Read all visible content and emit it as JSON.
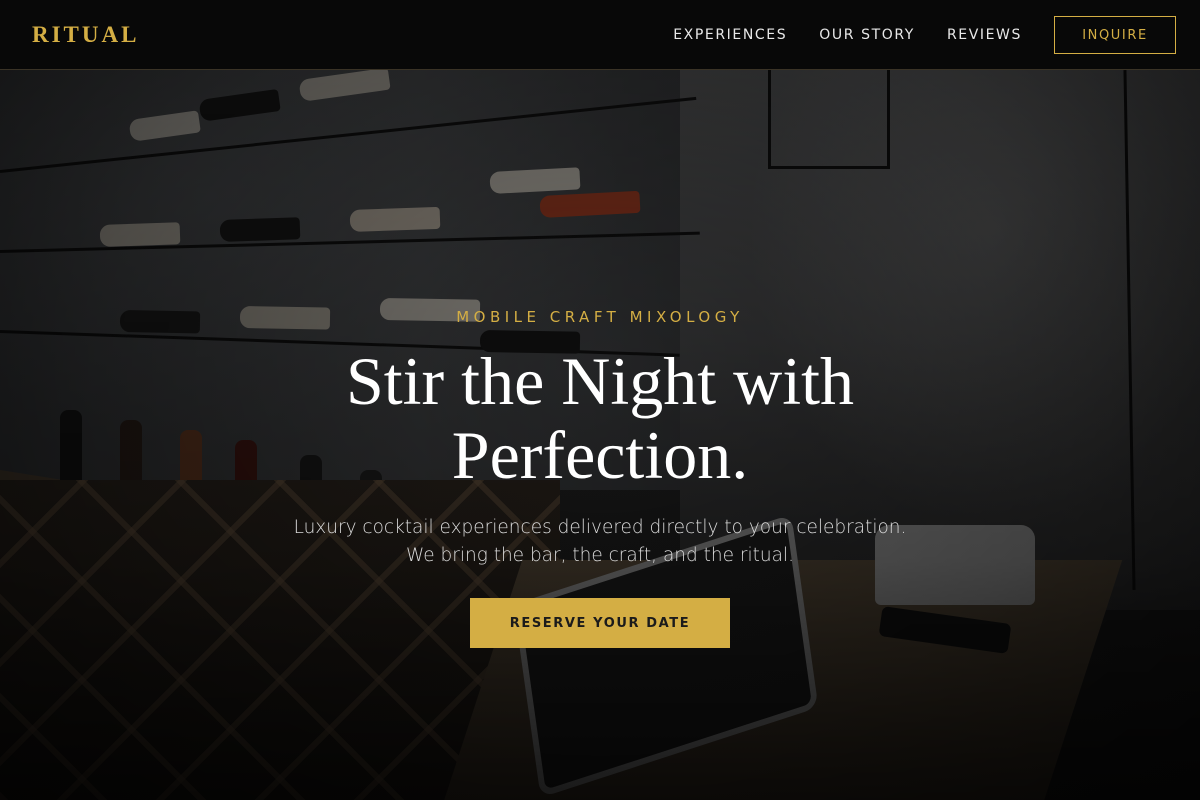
{
  "brand": {
    "logo_text": "RITUAL",
    "accent_color": "#d4ae44"
  },
  "nav": {
    "links": [
      {
        "label": "EXPERIENCES"
      },
      {
        "label": "OUR STORY"
      },
      {
        "label": "REVIEWS"
      }
    ],
    "cta_label": "INQUIRE"
  },
  "hero": {
    "eyebrow": "MOBILE CRAFT MIXOLOGY",
    "headline_line1": "Stir the Night with",
    "headline_line2": "Perfection.",
    "subtext_line1": "Luxury cocktail experiences delivered directly to your celebration.",
    "subtext_line2": "We bring the bar, the craft, and the ritual.",
    "cta_label": "RESERVE YOUR DATE",
    "background": "wine bar background photo"
  },
  "colors": {
    "navbar_bg": "#080808",
    "headline": "#ffffff",
    "cta_text": "#1b1b1b"
  }
}
